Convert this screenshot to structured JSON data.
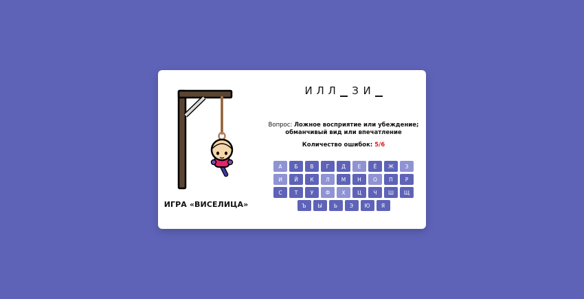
{
  "title": "ИГРА «ВИСЕЛИЦА»",
  "word": [
    {
      "char": "И",
      "guessed": true
    },
    {
      "char": "Л",
      "guessed": true
    },
    {
      "char": "Л",
      "guessed": true
    },
    {
      "char": "",
      "guessed": false
    },
    {
      "char": "З",
      "guessed": true
    },
    {
      "char": "И",
      "guessed": true
    },
    {
      "char": "",
      "guessed": false
    }
  ],
  "question": {
    "label": "Вопрос:",
    "text": "Ложное восприятие или убеждение; обманчивый вид или впечатление"
  },
  "errors": {
    "label": "Количество ошибок:",
    "count": "5/6"
  },
  "colors": {
    "background": "#5e63b8",
    "key": "#5e63b8",
    "key_used": "#8f93d4",
    "error": "#d91c1c"
  },
  "keyboard": [
    {
      "letter": "А",
      "used": true
    },
    {
      "letter": "Б",
      "used": false
    },
    {
      "letter": "В",
      "used": false
    },
    {
      "letter": "Г",
      "used": false
    },
    {
      "letter": "Д",
      "used": false
    },
    {
      "letter": "Е",
      "used": true
    },
    {
      "letter": "Ё",
      "used": false
    },
    {
      "letter": "Ж",
      "used": false
    },
    {
      "letter": "З",
      "used": true
    },
    {
      "letter": "И",
      "used": true
    },
    {
      "letter": "Й",
      "used": false
    },
    {
      "letter": "К",
      "used": false
    },
    {
      "letter": "Л",
      "used": true
    },
    {
      "letter": "М",
      "used": false
    },
    {
      "letter": "Н",
      "used": false
    },
    {
      "letter": "О",
      "used": true
    },
    {
      "letter": "П",
      "used": false
    },
    {
      "letter": "Р",
      "used": false
    },
    {
      "letter": "С",
      "used": false
    },
    {
      "letter": "Т",
      "used": false
    },
    {
      "letter": "У",
      "used": false
    },
    {
      "letter": "Ф",
      "used": true
    },
    {
      "letter": "Х",
      "used": true
    },
    {
      "letter": "Ц",
      "used": false
    },
    {
      "letter": "Ч",
      "used": false
    },
    {
      "letter": "Ш",
      "used": false
    },
    {
      "letter": "Щ",
      "used": false
    },
    {
      "letter": "Ъ",
      "used": false
    },
    {
      "letter": "Ы",
      "used": false
    },
    {
      "letter": "Ь",
      "used": false
    },
    {
      "letter": "Э",
      "used": false
    },
    {
      "letter": "Ю",
      "used": false
    },
    {
      "letter": "Я",
      "used": false
    }
  ]
}
